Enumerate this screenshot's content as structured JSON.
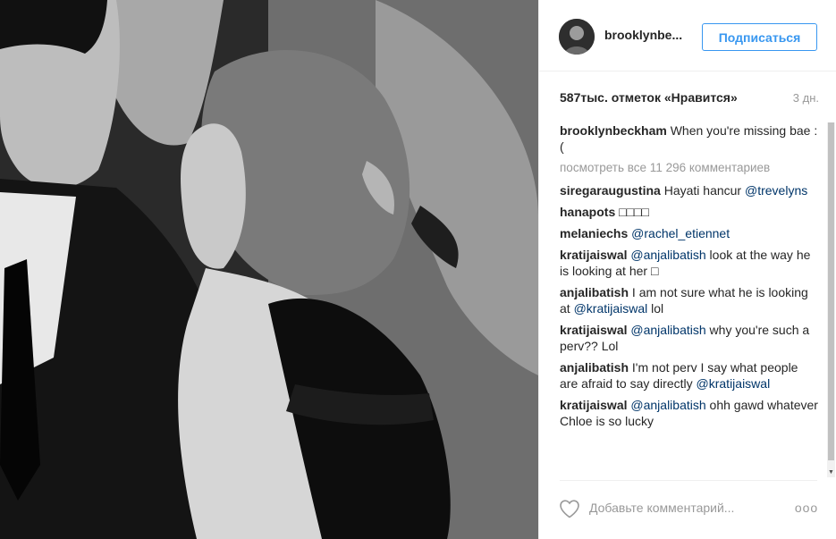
{
  "header": {
    "username": "brooklynbe...",
    "follow_label": "Подписаться"
  },
  "stats": {
    "likes": "587тыс. отметок «Нравится»",
    "time": "3 дн."
  },
  "caption": {
    "author": "brooklynbeckham",
    "text": " When you're missing bae :("
  },
  "view_all_label": "посмотреть все 11 296 комментариев",
  "comments": [
    {
      "author": "siregaraugustina",
      "text": " Hayati hancur ",
      "mention": "@trevelyns",
      "tail": ""
    },
    {
      "author": "hanapots",
      "text": " □□□□",
      "mention": "",
      "tail": ""
    },
    {
      "author": "melaniechs",
      "text": " ",
      "mention": "@rachel_etiennet",
      "tail": ""
    },
    {
      "author": "kratijaiswal",
      "text": " ",
      "mention": "@anjalibatish",
      "tail": " look at the way he is looking at her □"
    },
    {
      "author": "anjalibatish",
      "text": " I am not sure what he is looking at ",
      "mention": "@kratijaiswal",
      "tail": " lol"
    },
    {
      "author": "kratijaiswal",
      "text": " ",
      "mention": "@anjalibatish",
      "tail": " why you're such a perv?? Lol"
    },
    {
      "author": "anjalibatish",
      "text": " I'm not perv I say what people are afraid to say directly ",
      "mention": "@kratijaiswal",
      "tail": ""
    },
    {
      "author": "kratijaiswal",
      "text": " ",
      "mention": "@anjalibatish",
      "tail": " ohh gawd whatever Chloe is so lucky"
    }
  ],
  "footer": {
    "comment_placeholder": "Добавьте комментарий...",
    "more_label": "ooo"
  },
  "icons": {
    "like": "heart-icon",
    "more": "more-options-icon",
    "avatar": "avatar"
  },
  "colors": {
    "accent": "#3897f0",
    "mention": "#003569",
    "muted": "#999999"
  }
}
